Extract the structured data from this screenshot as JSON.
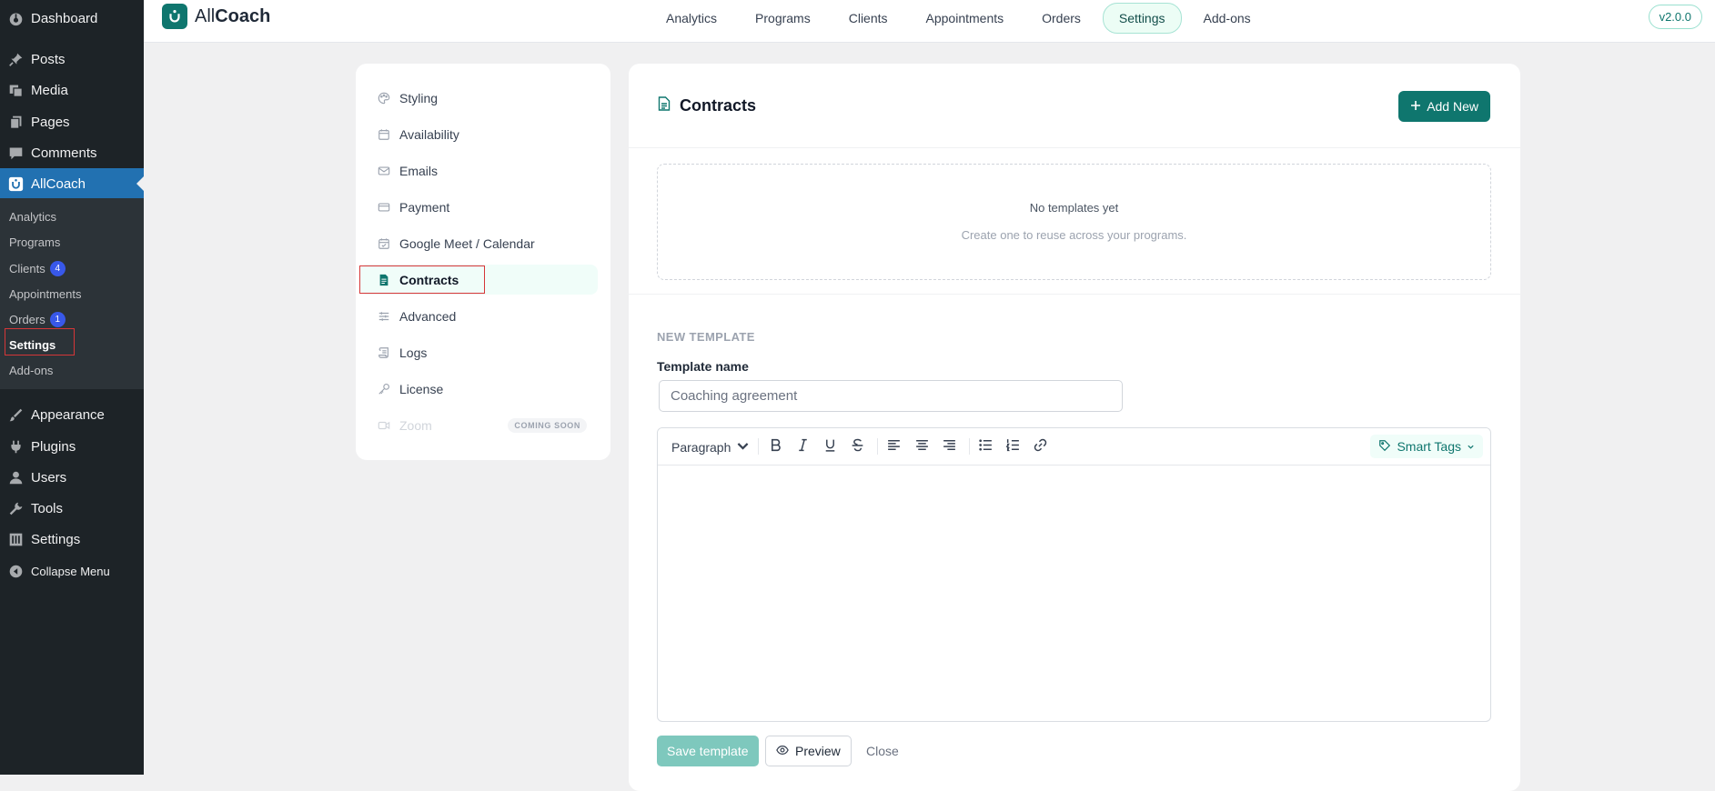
{
  "wp_menu": {
    "dashboard": "Dashboard",
    "posts": "Posts",
    "media": "Media",
    "pages": "Pages",
    "comments": "Comments",
    "allcoach": "AllCoach",
    "appearance": "Appearance",
    "plugins": "Plugins",
    "users": "Users",
    "tools": "Tools",
    "settings": "Settings",
    "collapse": "Collapse Menu"
  },
  "wp_submenu": {
    "analytics": "Analytics",
    "programs": "Programs",
    "clients": "Clients",
    "clients_count": "4",
    "appointments": "Appointments",
    "orders": "Orders",
    "orders_count": "1",
    "settings": "Settings",
    "addons": "Add-ons"
  },
  "app": {
    "brand_light": "All",
    "brand_bold": "Coach",
    "version": "v2.0.0",
    "accent": "#0f766e"
  },
  "topnav": {
    "analytics": "Analytics",
    "programs": "Programs",
    "clients": "Clients",
    "appointments": "Appointments",
    "orders": "Orders",
    "settings": "Settings",
    "addons": "Add-ons"
  },
  "settings_nav": {
    "styling": "Styling",
    "availability": "Availability",
    "emails": "Emails",
    "payment": "Payment",
    "google_meet": "Google Meet / Calendar",
    "contracts": "Contracts",
    "advanced": "Advanced",
    "logs": "Logs",
    "license": "License",
    "zoom": "Zoom",
    "coming_soon": "COMING SOON"
  },
  "contracts": {
    "title": "Contracts",
    "add_new": "Add New",
    "empty_title": "No templates yet",
    "empty_sub": "Create one to reuse across your programs."
  },
  "new_template": {
    "section": "NEW TEMPLATE",
    "name_label": "Template name",
    "name_placeholder": "Coaching agreement",
    "format_select": "Paragraph",
    "smart_tags": "Smart Tags",
    "save": "Save template",
    "preview": "Preview",
    "close": "Close"
  }
}
